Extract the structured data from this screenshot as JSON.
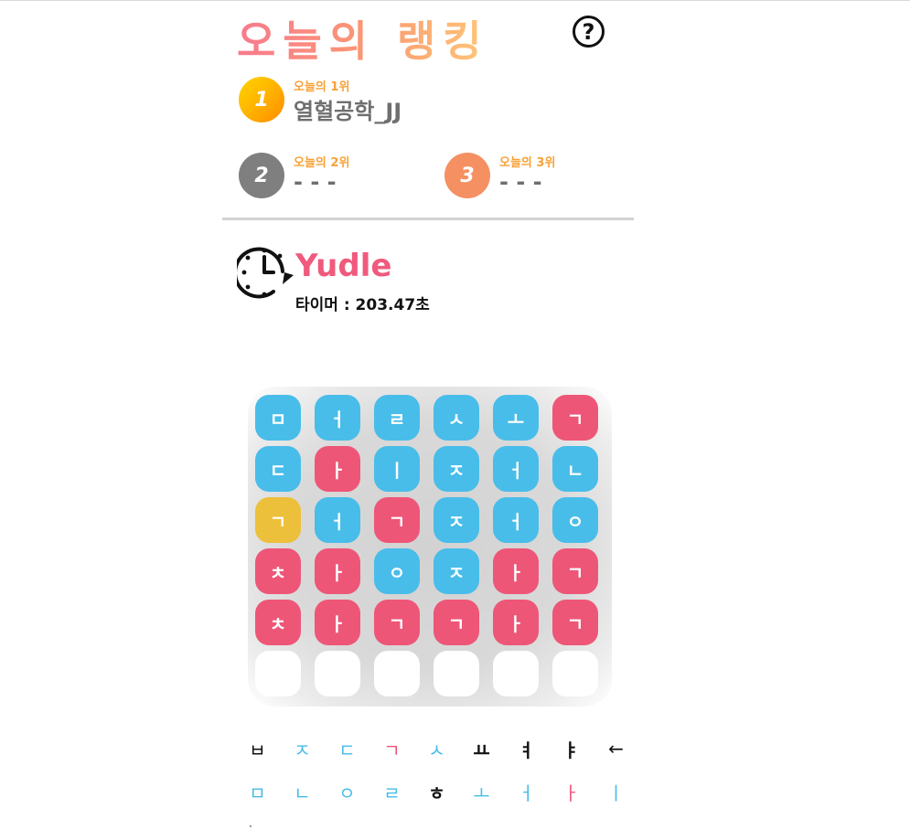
{
  "header": {
    "title": "오늘의 랭킹",
    "help_label": "?"
  },
  "ranking": {
    "first": {
      "medal": "1",
      "label": "오늘의 1위",
      "name": "열혈공학_JJ"
    },
    "second": {
      "medal": "2",
      "label": "오늘의 2위",
      "name": "- - -"
    },
    "third": {
      "medal": "3",
      "label": "오늘의 3위",
      "name": "- - -"
    }
  },
  "game": {
    "icon": "clock-timer-icon",
    "title": "Yudle",
    "timer": "타이머 : 203.47초"
  },
  "board": {
    "rows": [
      [
        {
          "ch": "ㅁ",
          "state": "blue"
        },
        {
          "ch": "ㅓ",
          "state": "blue"
        },
        {
          "ch": "ㄹ",
          "state": "blue"
        },
        {
          "ch": "ㅅ",
          "state": "blue"
        },
        {
          "ch": "ㅗ",
          "state": "blue"
        },
        {
          "ch": "ㄱ",
          "state": "pink"
        }
      ],
      [
        {
          "ch": "ㄷ",
          "state": "blue"
        },
        {
          "ch": "ㅏ",
          "state": "pink"
        },
        {
          "ch": "ㅣ",
          "state": "blue"
        },
        {
          "ch": "ㅈ",
          "state": "blue"
        },
        {
          "ch": "ㅓ",
          "state": "blue"
        },
        {
          "ch": "ㄴ",
          "state": "blue"
        }
      ],
      [
        {
          "ch": "ㄱ",
          "state": "yellow"
        },
        {
          "ch": "ㅓ",
          "state": "blue"
        },
        {
          "ch": "ㄱ",
          "state": "pink"
        },
        {
          "ch": "ㅈ",
          "state": "blue"
        },
        {
          "ch": "ㅓ",
          "state": "blue"
        },
        {
          "ch": "ㅇ",
          "state": "blue"
        }
      ],
      [
        {
          "ch": "ㅊ",
          "state": "pink"
        },
        {
          "ch": "ㅏ",
          "state": "pink"
        },
        {
          "ch": "ㅇ",
          "state": "blue"
        },
        {
          "ch": "ㅈ",
          "state": "blue"
        },
        {
          "ch": "ㅏ",
          "state": "pink"
        },
        {
          "ch": "ㄱ",
          "state": "pink"
        }
      ],
      [
        {
          "ch": "ㅊ",
          "state": "pink"
        },
        {
          "ch": "ㅏ",
          "state": "pink"
        },
        {
          "ch": "ㄱ",
          "state": "pink"
        },
        {
          "ch": "ㄱ",
          "state": "pink"
        },
        {
          "ch": "ㅏ",
          "state": "pink"
        },
        {
          "ch": "ㄱ",
          "state": "pink"
        }
      ],
      [
        {
          "ch": "",
          "state": "empty"
        },
        {
          "ch": "",
          "state": "empty"
        },
        {
          "ch": "",
          "state": "empty"
        },
        {
          "ch": "",
          "state": "empty"
        },
        {
          "ch": "",
          "state": "empty"
        },
        {
          "ch": "",
          "state": "empty"
        }
      ]
    ]
  },
  "keyboard": {
    "rows": [
      [
        {
          "ch": "ㅂ",
          "state": "neutral"
        },
        {
          "ch": "ㅈ",
          "state": "blue"
        },
        {
          "ch": "ㄷ",
          "state": "blue"
        },
        {
          "ch": "ㄱ",
          "state": "pink"
        },
        {
          "ch": "ㅅ",
          "state": "blue"
        },
        {
          "ch": "ㅛ",
          "state": "dark"
        },
        {
          "ch": "ㅕ",
          "state": "dark"
        },
        {
          "ch": "ㅑ",
          "state": "dark"
        },
        {
          "ch": "←",
          "state": "neutral"
        }
      ],
      [
        {
          "ch": "ㅁ",
          "state": "blue"
        },
        {
          "ch": "ㄴ",
          "state": "blue"
        },
        {
          "ch": "ㅇ",
          "state": "blue"
        },
        {
          "ch": "ㄹ",
          "state": "blue"
        },
        {
          "ch": "ㅎ",
          "state": "dark"
        },
        {
          "ch": "ㅗ",
          "state": "blue"
        },
        {
          "ch": "ㅓ",
          "state": "blue"
        },
        {
          "ch": "ㅏ",
          "state": "pink"
        },
        {
          "ch": "ㅣ",
          "state": "blue"
        }
      ]
    ]
  },
  "colors": {
    "tile_blue": "#48bde9",
    "tile_pink": "#ee5677",
    "tile_yellow": "#ecc03a",
    "rank_label": "#f7a136",
    "game_title": "#ef5a7d"
  }
}
